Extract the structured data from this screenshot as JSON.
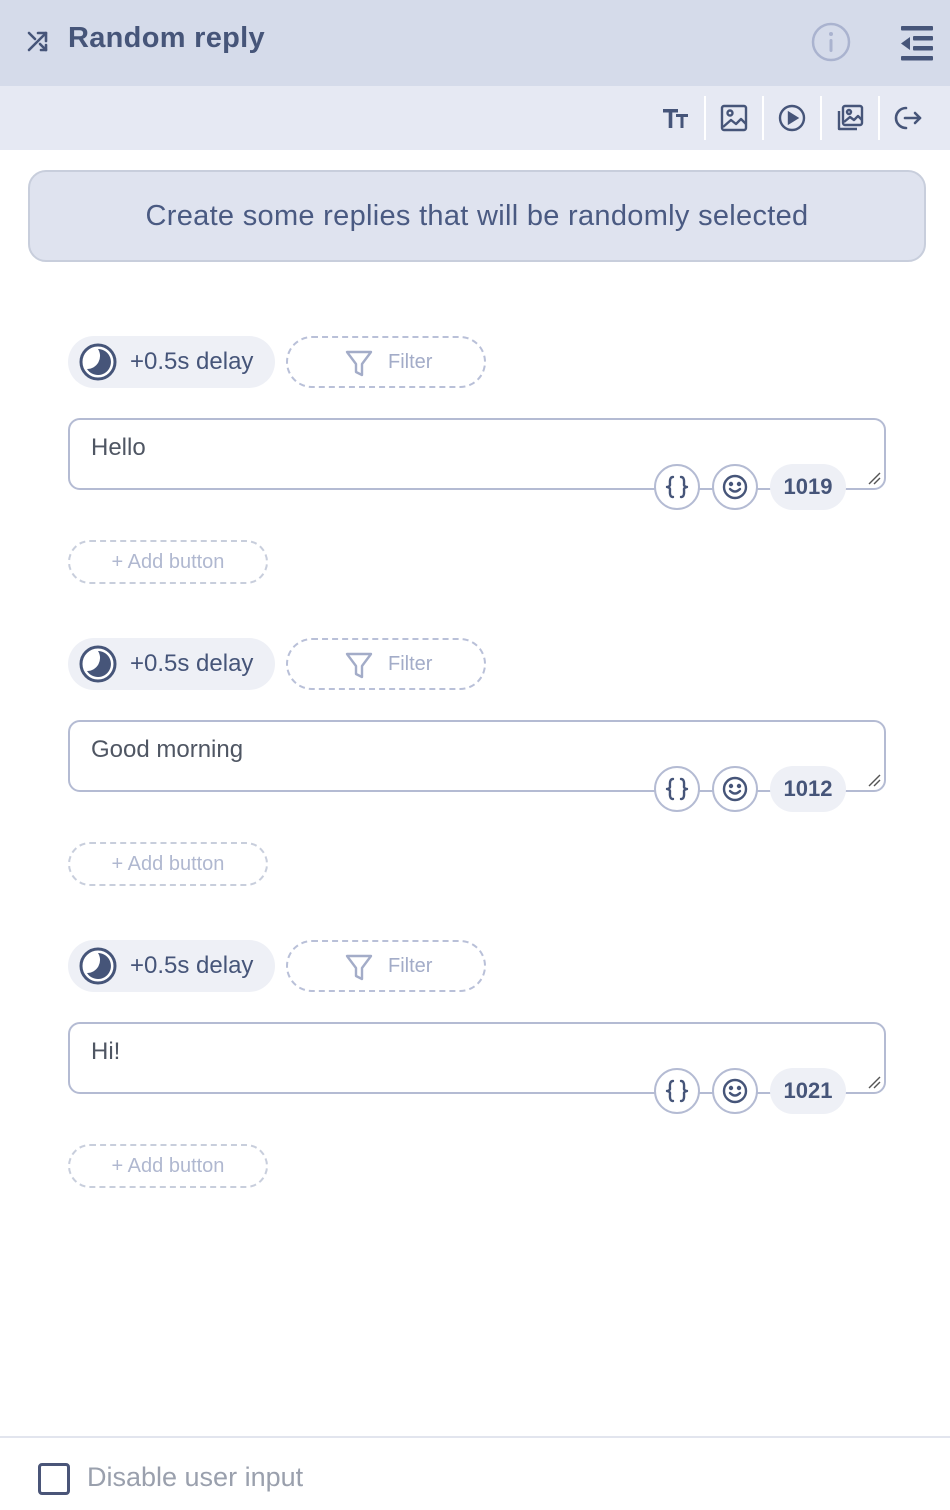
{
  "header": {
    "title": "Random reply",
    "icon": "shuffle-icon",
    "info_icon": "info-icon",
    "collapse_icon": "collapse-panel-icon"
  },
  "toolbar": {
    "buttons": [
      {
        "name": "text",
        "icon": "text-size-icon"
      },
      {
        "name": "image",
        "icon": "image-icon"
      },
      {
        "name": "video",
        "icon": "play-icon"
      },
      {
        "name": "gallery",
        "icon": "gallery-icon"
      },
      {
        "name": "exit",
        "icon": "exit-icon"
      }
    ]
  },
  "hint": "Create some replies that will be randomly selected",
  "replies": [
    {
      "delay": "+0.5s delay",
      "filter": "Filter",
      "text": "Hello",
      "count": "1019",
      "add_button": "+ Add button"
    },
    {
      "delay": "+0.5s delay",
      "filter": "Filter",
      "text": "Good morning",
      "count": "1012",
      "add_button": "+ Add button"
    },
    {
      "delay": "+0.5s delay",
      "filter": "Filter",
      "text": "Hi!",
      "count": "1021",
      "add_button": "+ Add button"
    }
  ],
  "footer": {
    "checkbox_label": "Disable user input",
    "checked": false
  },
  "colors": {
    "header_bg": "#d5dbea",
    "toolbar_bg": "#e6e9f3",
    "accent": "#465579"
  }
}
